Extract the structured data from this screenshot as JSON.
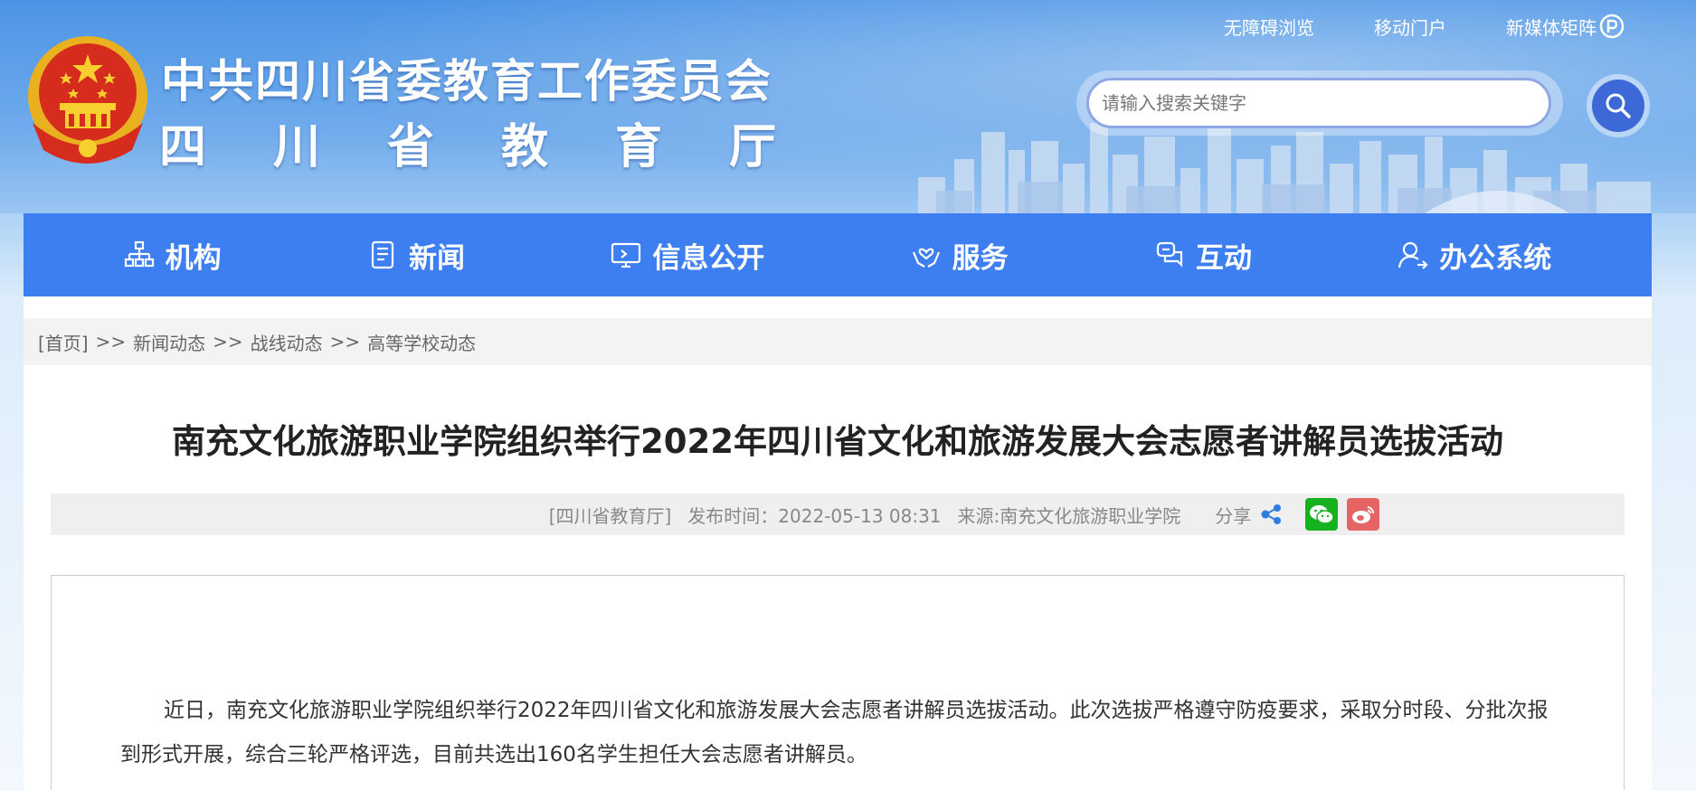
{
  "header": {
    "title_line1": "中共四川省委教育工作委员会",
    "title_line2": "四川省教育厅",
    "top_links": [
      "无障碍浏览",
      "移动门户",
      "新媒体矩阵"
    ],
    "search": {
      "placeholder": "请输入搜索关键字"
    }
  },
  "nav": {
    "items": [
      {
        "label": "机构",
        "icon": "org-chart-icon"
      },
      {
        "label": "新闻",
        "icon": "news-icon"
      },
      {
        "label": "信息公开",
        "icon": "monitor-icon"
      },
      {
        "label": "服务",
        "icon": "hands-heart-icon"
      },
      {
        "label": "互动",
        "icon": "chat-icon"
      },
      {
        "label": "办公系统",
        "icon": "user-arrow-icon"
      }
    ]
  },
  "breadcrumb": {
    "items": [
      "[首页]",
      "新闻动态",
      "战线动态",
      "高等学校动态"
    ],
    "separator": ">>"
  },
  "article": {
    "title": "南充文化旅游职业学院组织举行2022年四川省文化和旅游发展大会志愿者讲解员选拔活动",
    "publisher": "[四川省教育厅]",
    "publish_time": "发布时间：2022-05-13 08:31",
    "source": "来源:南充文化旅游职业学院",
    "share_label": "分享",
    "body": "近日，南充文化旅游职业学院组织举行2022年四川省文化和旅游发展大会志愿者讲解员选拔活动。此次选拔严格遵守防疫要求，采取分时段、分批次报到形式开展，综合三轮严格评选，目前共选出160名学生担任大会志愿者讲解员。"
  },
  "colors": {
    "nav_bg": "#3d7ef0",
    "search_button": "#3c69d6",
    "wechat": "#16b11e",
    "weibo": "#e66464"
  }
}
